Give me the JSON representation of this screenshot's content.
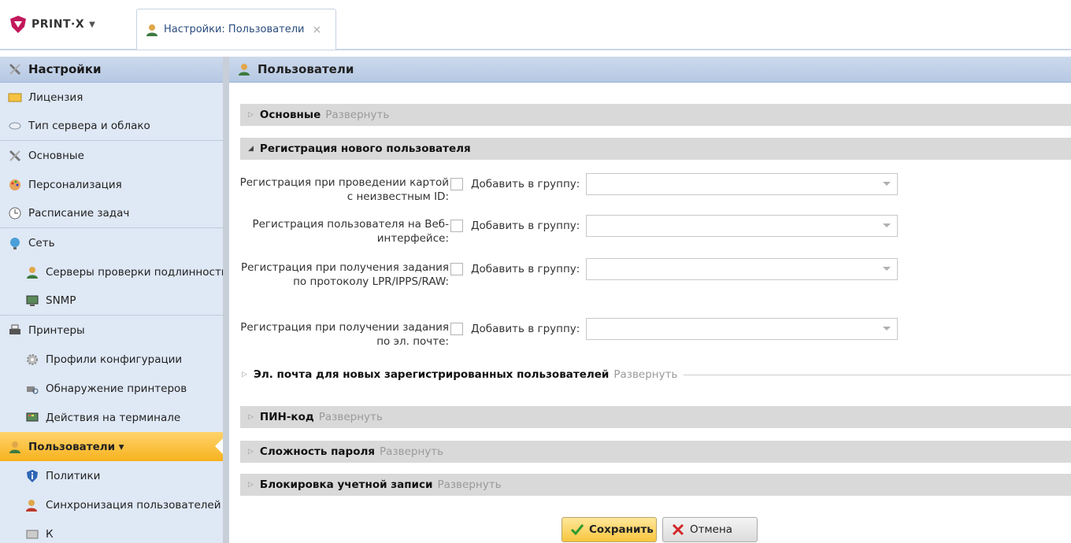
{
  "app": {
    "logo_text": "PRINT·X"
  },
  "tab": {
    "label": "Настройки: Пользователи",
    "close": "×"
  },
  "sidebar": {
    "title": "Настройки",
    "items": [
      {
        "label": "Лицензия"
      },
      {
        "label": "Тип сервера и облако"
      },
      {
        "label": "Основные"
      },
      {
        "label": "Персонализация"
      },
      {
        "label": "Расписание задач"
      },
      {
        "label": "Сеть"
      },
      {
        "label": "Серверы проверки подлинности"
      },
      {
        "label": "SNMP"
      },
      {
        "label": "Принтеры"
      },
      {
        "label": "Профили конфигурации"
      },
      {
        "label": "Обнаружение принтеров"
      },
      {
        "label": "Действия на терминале"
      },
      {
        "label": "Пользователи ▾"
      },
      {
        "label": "Политики"
      },
      {
        "label": "Синхронизация пользователей"
      },
      {
        "label": "К"
      }
    ]
  },
  "main": {
    "title": "Пользователи",
    "sections": [
      {
        "title": "Основные",
        "expand": "Развернуть"
      },
      {
        "title": "Регистрация нового пользователя",
        "expand": ""
      },
      {
        "title": "Эл. почта для новых зарегистрированных пользователей",
        "expand": "Развернуть"
      },
      {
        "title": "ПИН-код",
        "expand": "Развернуть"
      },
      {
        "title": "Сложность пароля",
        "expand": "Развернуть"
      },
      {
        "title": "Блокировка учетной записи",
        "expand": "Развернуть"
      }
    ],
    "registration_rows": [
      {
        "label": "Регистрация при проведении картой с неизвестным ID:",
        "checked": false,
        "add_label": "Добавить в группу:",
        "group_value": ""
      },
      {
        "label": "Регистрация пользователя на Веб-интерфейсе:",
        "checked": false,
        "add_label": "Добавить в группу:",
        "group_value": ""
      },
      {
        "label": "Регистрация при получения задания по протоколу LPR/IPPS/RAW:",
        "checked": false,
        "add_label": "Добавить в группу:",
        "group_value": ""
      },
      {
        "label": "Регистрация при получении задания по эл. почте:",
        "checked": false,
        "add_label": "Добавить в группу:",
        "group_value": ""
      }
    ],
    "buttons": {
      "save": "Сохранить",
      "cancel": "Отмена"
    }
  },
  "colors": {
    "accent": "#f8c63e",
    "header": "#cddaed",
    "sidebar_bg": "#dfe8f5"
  }
}
